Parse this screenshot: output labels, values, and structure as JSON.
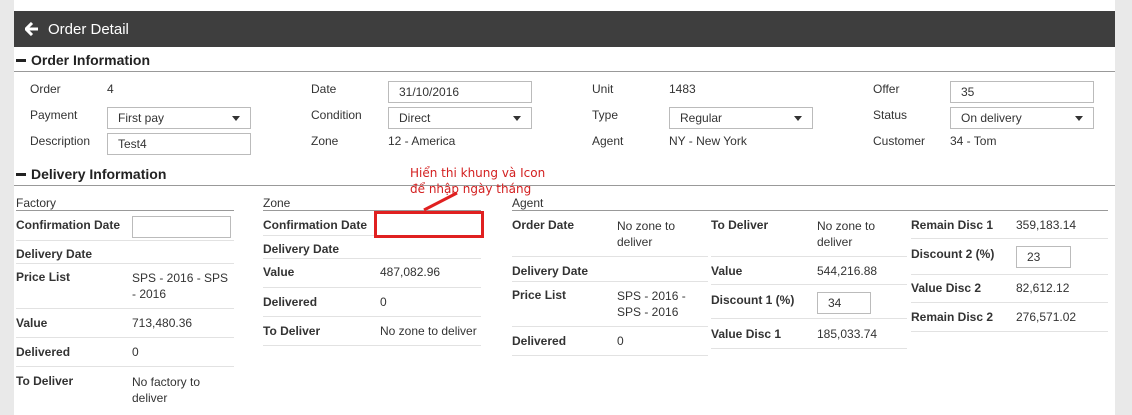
{
  "header": {
    "title": "Order Detail",
    "back_icon": "arrow-left-icon"
  },
  "order_info": {
    "title": "Order Information",
    "order_label": "Order",
    "order_value": "4",
    "date_label": "Date",
    "date_value": "31/10/2016",
    "unit_label": "Unit",
    "unit_value": "1483",
    "offer_label": "Offer",
    "offer_value": "35",
    "payment_label": "Payment",
    "payment_value": "First pay",
    "condition_label": "Condition",
    "condition_value": "Direct",
    "type_label": "Type",
    "type_value": "Regular",
    "status_label": "Status",
    "status_value": "On delivery",
    "description_label": "Description",
    "description_value": "Test4",
    "zone_label": "Zone",
    "zone_value": "12 - America",
    "agent_label": "Agent",
    "agent_value": "NY - New York",
    "customer_label": "Customer",
    "customer_value": "34 - Tom"
  },
  "delivery_info": {
    "title": "Delivery Information",
    "factory": {
      "title": "Factory",
      "confirmation_date_label": "Confirmation Date",
      "confirmation_date_value": "",
      "delivery_date_label": "Delivery Date",
      "price_list_label": "Price List",
      "price_list_value": "SPS - 2016 - SPS - 2016",
      "value_label": "Value",
      "value_value": "713,480.36",
      "delivered_label": "Delivered",
      "delivered_value": "0",
      "to_deliver_label": "To Deliver",
      "to_deliver_value": "No factory to deliver"
    },
    "zone": {
      "title": "Zone",
      "confirmation_date_label": "Confirmation Date",
      "delivery_date_label": "Delivery Date",
      "value_label": "Value",
      "value_value": "487,082.96",
      "delivered_label": "Delivered",
      "delivered_value": "0",
      "to_deliver_label": "To Deliver",
      "to_deliver_value": "No zone to deliver"
    },
    "agent": {
      "title": "Agent",
      "order_date_label": "Order Date",
      "order_date_value": "No zone to deliver",
      "delivery_date_label": "Delivery Date",
      "price_list_label": "Price List",
      "price_list_value": "SPS - 2016 - SPS - 2016",
      "delivered_label": "Delivered",
      "delivered_value": "0",
      "to_deliver_label": "To Deliver",
      "to_deliver_value": "No zone to deliver",
      "value_label": "Value",
      "value_value": "544,216.88",
      "discount1_label": "Discount 1 (%)",
      "discount1_value": "34",
      "value_disc1_label": "Value Disc 1",
      "value_disc1_value": "185,033.74",
      "remain_disc1_label": "Remain Disc 1",
      "remain_disc1_value": "359,183.14",
      "discount2_label": "Discount 2 (%)",
      "discount2_value": "23",
      "value_disc2_label": "Value Disc 2",
      "value_disc2_value": "82,612.12",
      "remain_disc2_label": "Remain Disc 2",
      "remain_disc2_value": "276,571.02"
    }
  },
  "annotation": {
    "line1": "Hiển thi khung và Icon",
    "line2": "để nhập ngày tháng",
    "color": "#e02020"
  }
}
